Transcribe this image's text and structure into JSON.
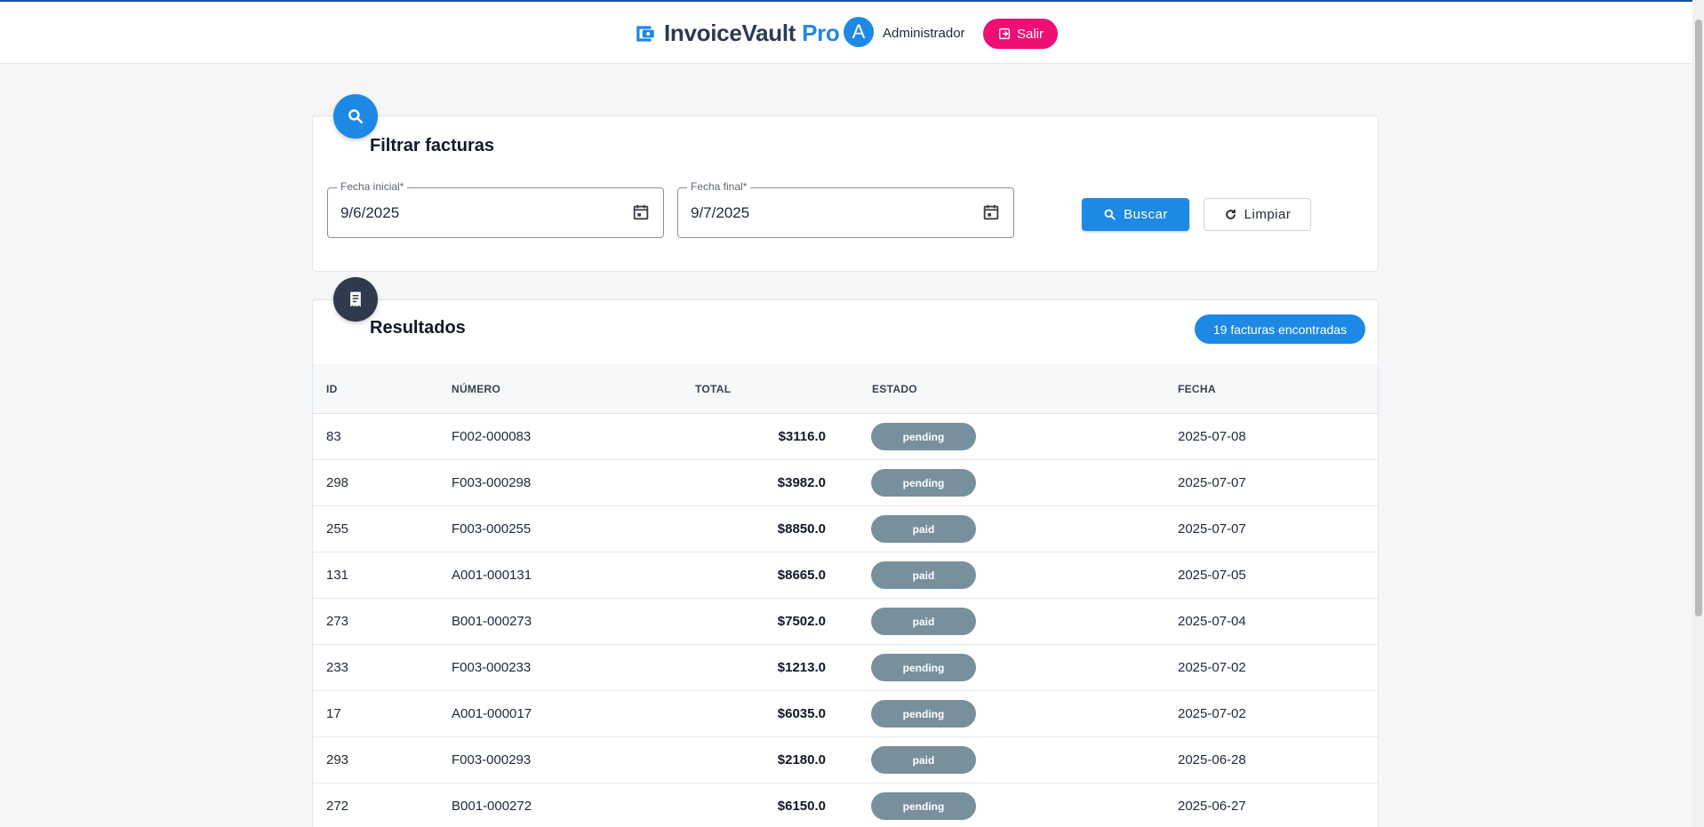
{
  "header": {
    "brand_main": "InvoiceVault",
    "brand_accent": "Pro",
    "avatar_letter": "A",
    "user_name": "Administrador",
    "logout_label": "Salir"
  },
  "filter": {
    "title": "Filtrar facturas",
    "start_label": "Fecha inicial",
    "start_value": "9/6/2025",
    "end_label": "Fecha final",
    "end_value": "9/7/2025",
    "required_mark": "*",
    "search_label": "Buscar",
    "clear_label": "Limpiar"
  },
  "results": {
    "title": "Resultados",
    "count_text": "19 facturas encontradas",
    "columns": [
      "ID",
      "NÚMERO",
      "TOTAL",
      "ESTADO",
      "FECHA"
    ],
    "rows": [
      {
        "id": "83",
        "number": "F002-000083",
        "total": "$3116.0",
        "status": "pending",
        "date": "2025-07-08"
      },
      {
        "id": "298",
        "number": "F003-000298",
        "total": "$3982.0",
        "status": "pending",
        "date": "2025-07-07"
      },
      {
        "id": "255",
        "number": "F003-000255",
        "total": "$8850.0",
        "status": "paid",
        "date": "2025-07-07"
      },
      {
        "id": "131",
        "number": "A001-000131",
        "total": "$8665.0",
        "status": "paid",
        "date": "2025-07-05"
      },
      {
        "id": "273",
        "number": "B001-000273",
        "total": "$7502.0",
        "status": "paid",
        "date": "2025-07-04"
      },
      {
        "id": "233",
        "number": "F003-000233",
        "total": "$1213.0",
        "status": "pending",
        "date": "2025-07-02"
      },
      {
        "id": "17",
        "number": "A001-000017",
        "total": "$6035.0",
        "status": "pending",
        "date": "2025-07-02"
      },
      {
        "id": "293",
        "number": "F003-000293",
        "total": "$2180.0",
        "status": "paid",
        "date": "2025-06-28"
      },
      {
        "id": "272",
        "number": "B001-000272",
        "total": "$6150.0",
        "status": "pending",
        "date": "2025-06-27"
      }
    ]
  },
  "colors": {
    "primary": "#1e88e5",
    "logout": "#ee0e74",
    "status_pill": "#78909c",
    "results_icon_bg": "#2f3a4c"
  }
}
